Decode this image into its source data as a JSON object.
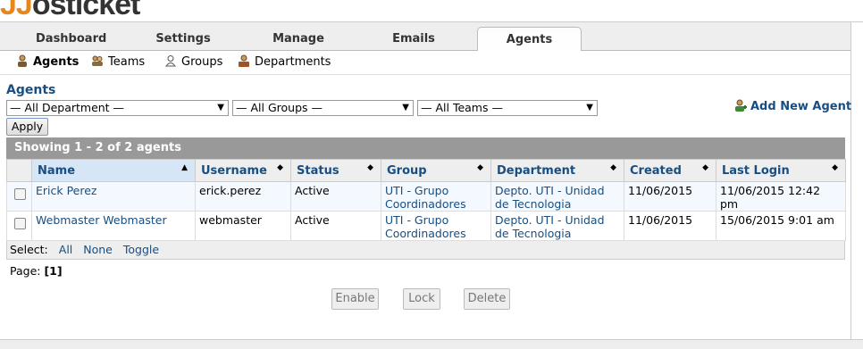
{
  "brand": {
    "logo_prefix": "JJ",
    "logo_o": "os",
    "logo_rest": "ticket"
  },
  "nav": {
    "tabs": [
      {
        "label": "Dashboard"
      },
      {
        "label": "Settings"
      },
      {
        "label": "Manage"
      },
      {
        "label": "Emails"
      },
      {
        "label": "Agents"
      }
    ],
    "active": "Agents"
  },
  "subnav": {
    "items": [
      {
        "label": "Agents",
        "icon": "agent-icon"
      },
      {
        "label": "Teams",
        "icon": "teams-icon"
      },
      {
        "label": "Groups",
        "icon": "groups-icon"
      },
      {
        "label": "Departments",
        "icon": "departments-icon"
      }
    ]
  },
  "page": {
    "title": "Agents",
    "add_label": "Add New Agent"
  },
  "filters": {
    "department": "— All Department —",
    "groups": "— All Groups —",
    "teams": "— All Teams —",
    "apply": "Apply"
  },
  "table": {
    "caption": "Showing  1 - 2 of 2 agents",
    "columns": [
      "Name",
      "Username",
      "Status",
      "Group",
      "Department",
      "Created",
      "Last Login"
    ],
    "rows": [
      {
        "name": "Erick Perez",
        "username": "erick.perez",
        "status": "Active",
        "group": "UTI - Grupo Coordinadores",
        "department": "Depto. UTI - Unidad de Tecnologia",
        "created": "11/06/2015",
        "last_login": "11/06/2015 12:42 pm"
      },
      {
        "name": "Webmaster Webmaster",
        "username": "webmaster",
        "status": "Active",
        "group": "UTI - Grupo Coordinadores",
        "department": "Depto. UTI - Unidad de Tecnologia",
        "created": "11/06/2015",
        "last_login": "15/06/2015 9:01 am"
      }
    ],
    "select_label": "Select:",
    "select_all": "All",
    "select_none": "None",
    "select_toggle": "Toggle"
  },
  "pagination": {
    "label": "Page:",
    "current": "[1]"
  },
  "actions": {
    "enable": "Enable",
    "lock": "Lock",
    "delete": "Delete"
  }
}
